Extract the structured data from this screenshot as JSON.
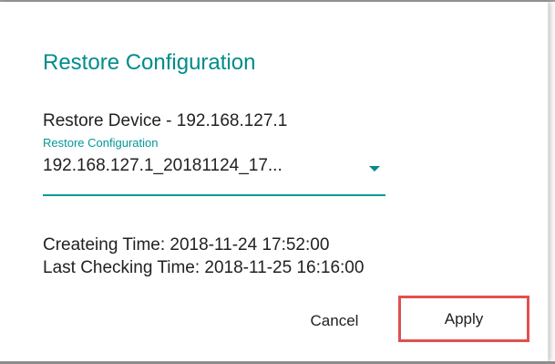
{
  "dialog": {
    "title": "Restore Configuration",
    "device_line": "Restore Device - 192.168.127.1",
    "select": {
      "label": "Restore Configuration",
      "value": "192.168.127.1_20181124_17...",
      "arrow_icon": "caret-down-icon"
    },
    "info": {
      "created": "Createing Time: 2018-11-24 17:52:00",
      "last_checked": "Last Checking Time: 2018-11-25 16:16:00"
    },
    "buttons": {
      "cancel": "Cancel",
      "apply": "Apply"
    }
  },
  "colors": {
    "accent": "#008c8c",
    "highlight_border": "#e05050",
    "text": "#212121"
  }
}
